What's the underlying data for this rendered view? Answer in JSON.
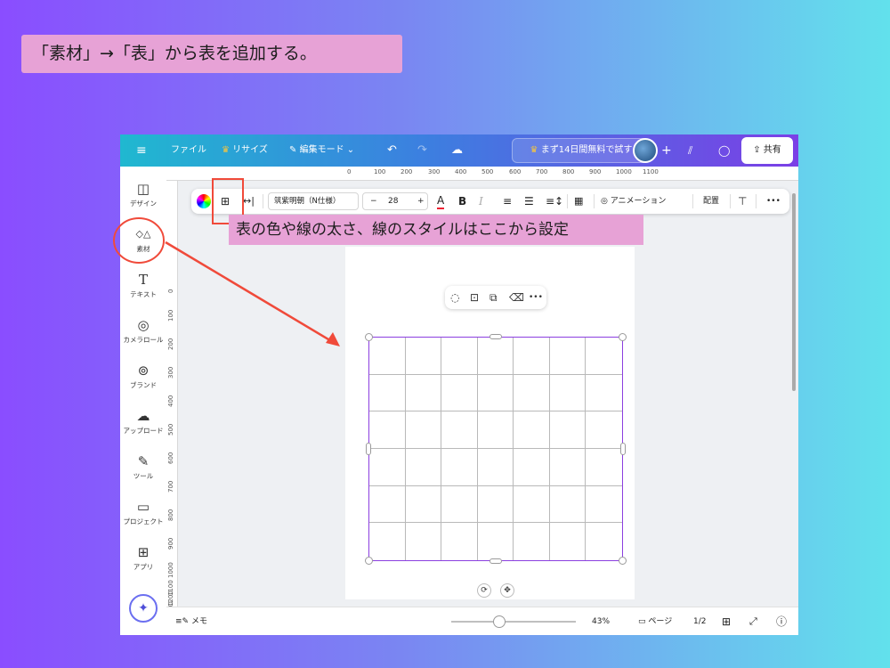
{
  "caption": "「素材」→「表」から表を追加する。",
  "topbar": {
    "menu_icon": "≡",
    "file": "ファイル",
    "resize": "リサイズ",
    "edit_mode": "編集モード",
    "trial": "まず14日間無料で試す",
    "share": "共有"
  },
  "sidebar": {
    "items": [
      {
        "icon": "design-icon",
        "glyph": "◫",
        "label": "デザイン"
      },
      {
        "icon": "elements-icon",
        "glyph": "◇△",
        "label": "素材"
      },
      {
        "icon": "text-icon",
        "glyph": "T",
        "label": "テキスト"
      },
      {
        "icon": "camera-icon",
        "glyph": "◎",
        "label": "カメラロール"
      },
      {
        "icon": "brand-icon",
        "glyph": "⊚",
        "label": "ブランド"
      },
      {
        "icon": "upload-icon",
        "glyph": "☁",
        "label": "アップロード"
      },
      {
        "icon": "tools-icon",
        "glyph": "✎",
        "label": "ツール"
      },
      {
        "icon": "folder-icon",
        "glyph": "▭",
        "label": "プロジェクト"
      },
      {
        "icon": "apps-icon",
        "glyph": "⊞",
        "label": "アプリ"
      }
    ]
  },
  "ruler": {
    "top": [
      "0",
      "100",
      "200",
      "300",
      "400",
      "500",
      "600",
      "700",
      "800",
      "900",
      "1000",
      "1100"
    ],
    "left": [
      "0",
      "100",
      "200",
      "300",
      "400",
      "500",
      "600",
      "700",
      "800",
      "900",
      "1000",
      "1100",
      "1200",
      "1300"
    ]
  },
  "toolbar": {
    "font": "筑紫明朝（N仕様）",
    "font_size": "28",
    "minus": "−",
    "plus": "+",
    "animation": "アニメーション",
    "position": "配置",
    "more": "•••"
  },
  "hint": "表の色や線の太さ、線のスタイルはここから設定",
  "bottombar": {
    "notes": "メモ",
    "zoom": "43%",
    "pages_label": "ページ",
    "page_count": "1/2"
  },
  "colors": {
    "accent": "#8b3fe0",
    "annotation": "#f04a3a",
    "highlight": "#e7a2d6"
  }
}
